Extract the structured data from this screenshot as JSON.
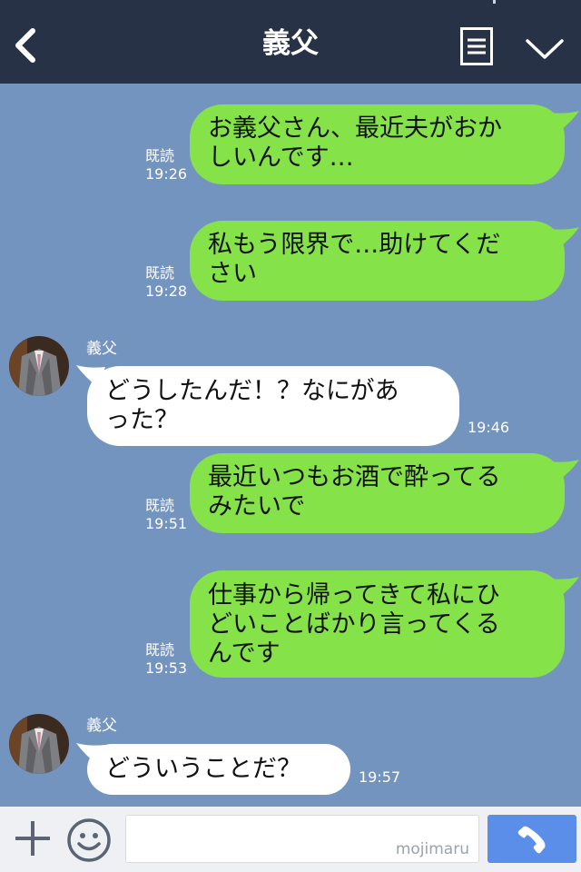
{
  "header": {
    "title": "義父"
  },
  "messages": [
    {
      "dir": "out",
      "text": "お義父さん、最近夫がおか\nしいんです…",
      "read": "既読",
      "time": "19:26"
    },
    {
      "dir": "out",
      "text": "私もう限界で…助けてくだ\nさい",
      "read": "既読",
      "time": "19:28"
    },
    {
      "dir": "in",
      "sender": "義父",
      "text": "どうしたんだ！？なにがあ\nった？",
      "time": "19:46"
    },
    {
      "dir": "out",
      "text": "最近いつもお酒で酔ってる\nみたいで",
      "read": "既読",
      "time": "19:51"
    },
    {
      "dir": "out",
      "text": "仕事から帰ってきて私にひ\nどいことばかり言ってくる\nんです",
      "read": "既読",
      "time": "19:53"
    },
    {
      "dir": "in",
      "sender": "義父",
      "text": "どういうことだ？",
      "time": "19:57"
    }
  ],
  "input": {
    "placeholder": "",
    "watermark": "mojimaru"
  },
  "icons": {
    "back": "back-chevron-icon",
    "menu": "menu-list-icon",
    "collapse": "chevron-down-icon",
    "add": "plus-icon",
    "emoji": "smiley-icon",
    "call": "phone-icon"
  },
  "colors": {
    "header": "#273246",
    "background": "#7494c0",
    "outgoing_bubble": "#85e249",
    "incoming_bubble": "#ffffff",
    "call_button": "#5b8ee8"
  }
}
